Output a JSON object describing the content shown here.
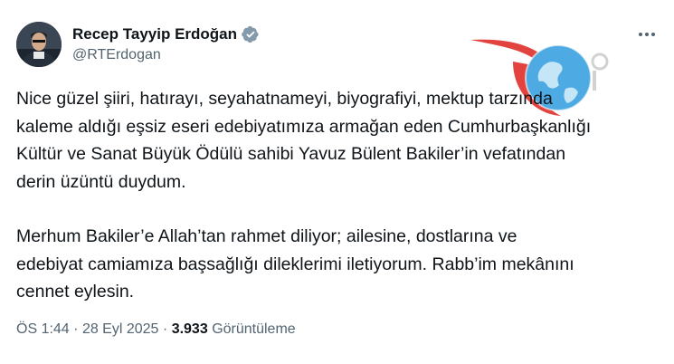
{
  "author": {
    "display_name": "Recep Tayyip Erdoğan",
    "handle": "@RTErdogan",
    "verified_color": "#829aab"
  },
  "tweet": {
    "paragraphs": [
      [
        "Nice güzel şiiri, hatırayı, seyahatnameyi, biyografiyi, mektup tarzında",
        "kaleme aldığı eşsiz eseri edebiyatımıza armağan eden Cumhurbaşkanlığı",
        "Kültür ve Sanat Büyük Ödülü sahibi Yavuz Bülent Bakiler’in vefatından",
        "derin üzüntü duydum."
      ],
      [
        "Merhum Bakiler’e Allah’tan rahmet diliyor; ailesine, dostlarına ve",
        "edebiyat camiamıza başsağlığı dileklerimi iletiyorum. Rabb’im mekânını",
        "cennet eylesin."
      ]
    ]
  },
  "meta": {
    "time": "ÖS 1:44",
    "separator": "·",
    "date": "28 Eyl 2025",
    "views_count": "3.933",
    "views_label": "Görüntüleme"
  },
  "icons": {
    "verified": "verified-badge-icon",
    "more": "more-options-icon"
  },
  "colors": {
    "text": "#0f1419",
    "secondary": "#536471",
    "background": "#ffffff"
  }
}
